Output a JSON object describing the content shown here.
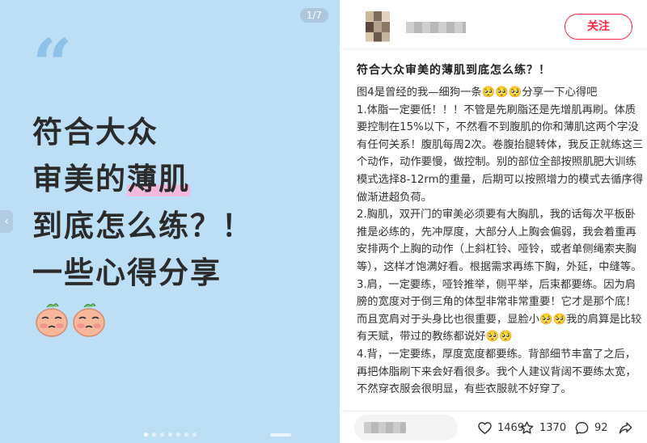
{
  "media": {
    "page_counter": "1/7",
    "quote_mark": "“",
    "cover_lines": [
      {
        "before": "符合大众",
        "highlight": "",
        "after": ""
      },
      {
        "before": "审美的",
        "highlight": "薄肌",
        "after": ""
      },
      {
        "before": "到底怎么练？！",
        "highlight": "",
        "after": ""
      },
      {
        "before": "一些心得分享",
        "highlight": "",
        "after": ""
      }
    ],
    "carousel_total": 7,
    "carousel_index": 1
  },
  "author": {
    "follow_label": "关注"
  },
  "post": {
    "title": "符合大众审美的薄肌到底怎么练？！",
    "paragraphs": [
      "图4是曾经的我—细狗一条🥺🥺🥺分享一下心得吧",
      "1.体脂一定要低！！！不管是先刷脂还是先增肌再刷。体质要控制在15%以下，不然看不到腹肌的你和薄肌这两个字没有任何关系！腹肌每周2次。卷腹抬腿转体，我反正就练这三个动作，动作要慢，做控制。别的部位全部按照肌肥大训练模式选择8-12rm的重量，后期可以按照增力的模式去循序得做渐进超负荷。",
      "2.胸肌，双开门的审美必须要有大胸肌，我的话每次平板卧推是必练的，先冲厚度，大部分人上胸会偏弱，我会着重再安排两个上胸的动作（上斜杠铃、哑铃，或者单侧绳索夹胸等），这样才饱满好看。根据需求再练下胸，外延，中缝等。",
      "3.肩，一定要练，哑铃推举，侧平举，后束都要练。因为肩膀的宽度对于倒三角的体型非常非常重要！它才是那个底！而且宽肩对于头身比也很重要，显脸小🥺🥺我的肩算是比较有天赋，带过的教练都说好🥺🥺",
      "4.背，一定要练，厚度宽度都要练。背部细节丰富了之后，再把体脂刷下来会好看很多。我个人建议背阔不要练太宽，不然穿衣服会很明显，有些衣服就不好穿了。"
    ]
  },
  "actions": {
    "likes": "1469",
    "collects": "1370",
    "comments": "92",
    "like_icon": "heart-icon",
    "collect_icon": "star-icon",
    "comment_icon": "comment-bubble-icon",
    "share_icon": "share-arrow-icon"
  },
  "colors": {
    "accent": "#ff2442",
    "cover_background": "#bcdff6",
    "highlight": "#f3b9dd"
  }
}
